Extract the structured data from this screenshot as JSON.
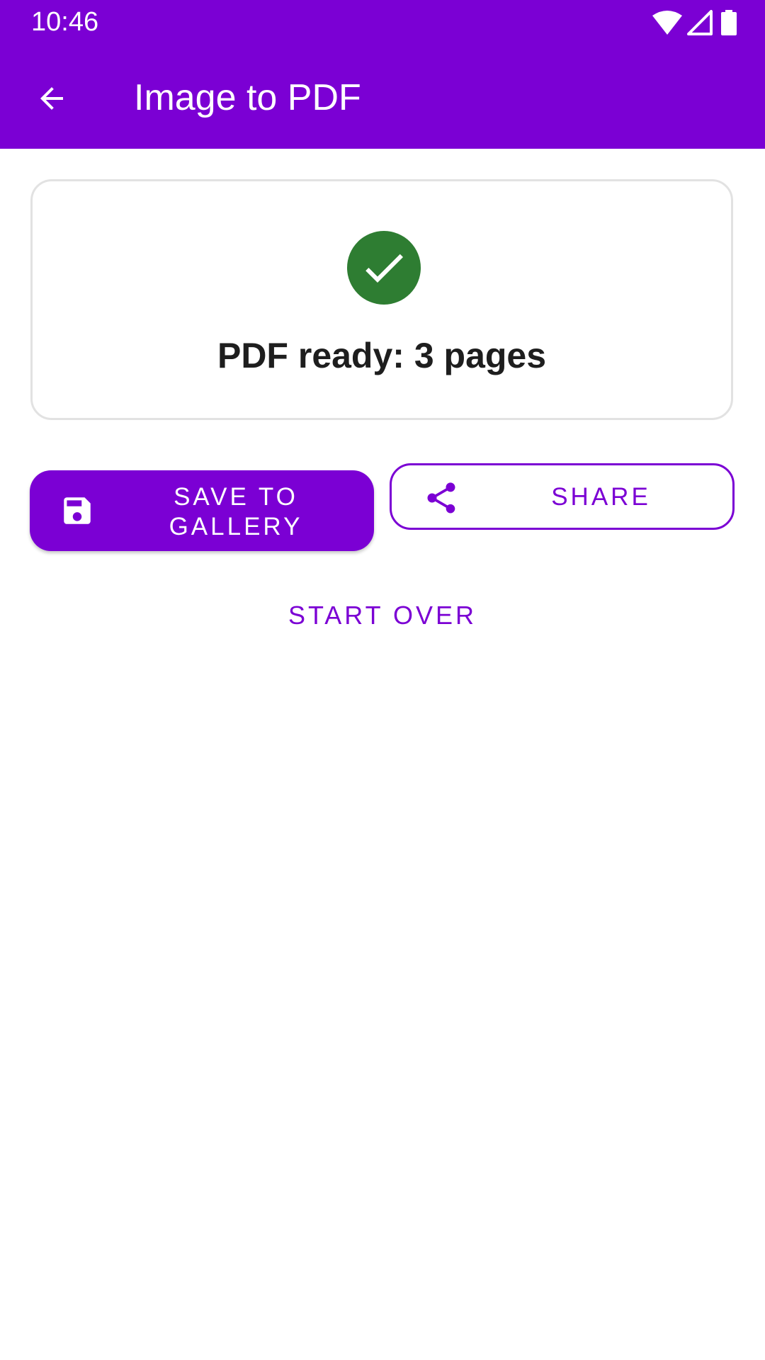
{
  "status_bar": {
    "time": "10:46",
    "icons": [
      "wifi-icon",
      "cellular-signal-icon",
      "battery-icon"
    ]
  },
  "app_bar": {
    "title": "Image to PDF",
    "back_icon": "arrow-back-icon"
  },
  "result": {
    "icon": "check-circle-icon",
    "message": "PDF ready: 3 pages"
  },
  "actions": {
    "save_label": "SAVE TO GALLERY",
    "save_icon": "floppy-disk-icon",
    "share_label": "SHARE",
    "share_icon": "share-icon",
    "start_over_label": "START OVER"
  },
  "colors": {
    "primary": "#7B00D4",
    "success": "#2E7D32",
    "text": "#1E1E1E",
    "card_border": "#E2E2E2"
  }
}
